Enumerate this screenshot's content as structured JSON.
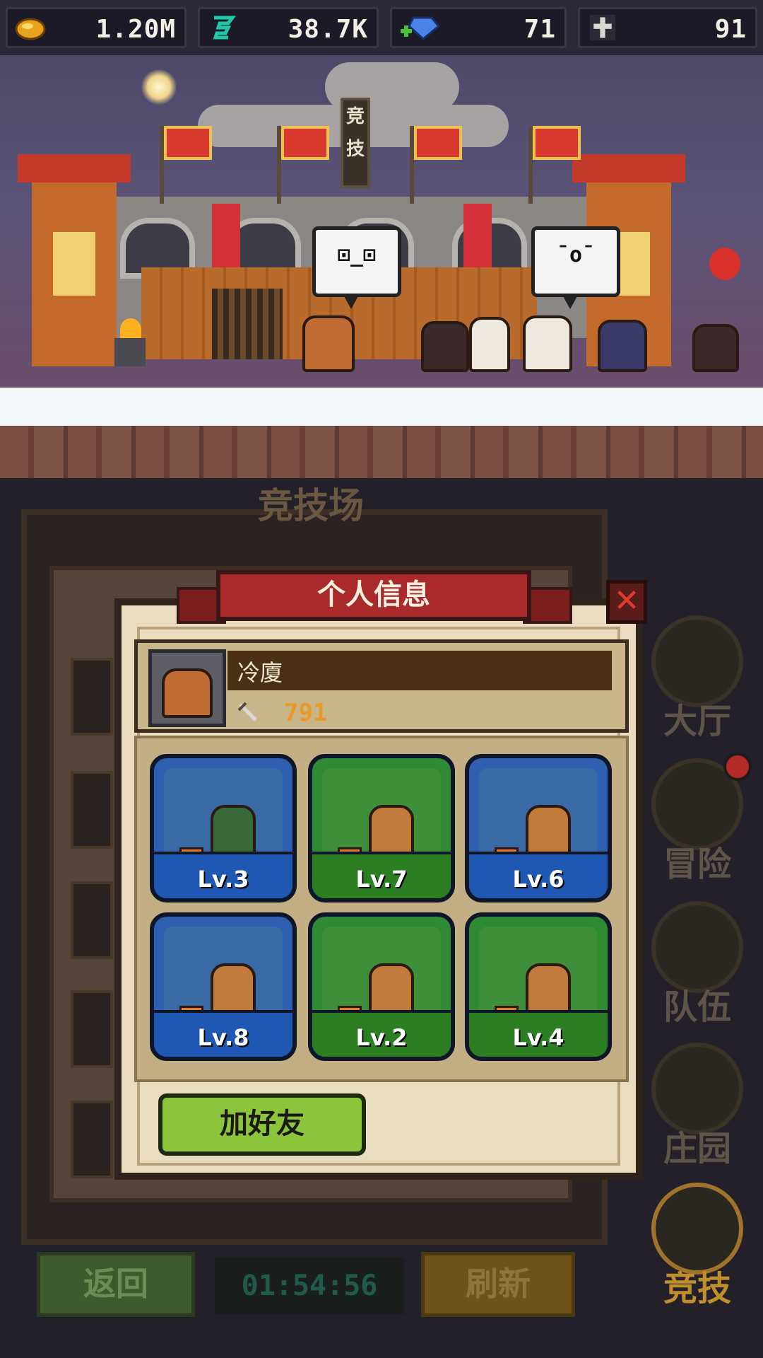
{
  "resources": {
    "gold": "1.20M",
    "energy": "38.7K",
    "gems": "71",
    "cross": "91"
  },
  "scene": {
    "sign_text_1": "竞",
    "sign_text_2": "技",
    "bubble_left_face": "⊡_⊡",
    "bubble_right_face": "ˉoˉ"
  },
  "arena": {
    "title": "竞技场",
    "back_label": "返回",
    "timer": "01:54:56",
    "refresh_label": "刷新"
  },
  "side_nav": [
    {
      "label": "大厅",
      "icon": "hall-icon"
    },
    {
      "label": "冒险",
      "icon": "adventure-icon"
    },
    {
      "label": "队伍",
      "icon": "team-icon"
    },
    {
      "label": "庄园",
      "icon": "manor-icon"
    },
    {
      "label": "竞技",
      "icon": "arena-swords-icon",
      "active": true
    }
  ],
  "modal": {
    "title": "个人信息",
    "close_icon": "close-icon",
    "player": {
      "name": "冷廈",
      "power": "791"
    },
    "heroes": [
      {
        "level": "Lv.3",
        "frame": "blue",
        "type": "archer"
      },
      {
        "level": "Lv.7",
        "frame": "green",
        "type": "staff"
      },
      {
        "level": "Lv.6",
        "frame": "blue",
        "type": "spear"
      },
      {
        "level": "Lv.8",
        "frame": "blue",
        "type": "sword"
      },
      {
        "level": "Lv.2",
        "frame": "green",
        "type": "staff"
      },
      {
        "level": "Lv.4",
        "frame": "green",
        "type": "club"
      }
    ],
    "add_friend_label": "加好友"
  },
  "colors": {
    "blue_frame": "#2f5fb0",
    "green_frame": "#2f8a34",
    "power": "#e89a28",
    "ribbon": "#a82a2a",
    "add_friend": "#8cc53c"
  }
}
